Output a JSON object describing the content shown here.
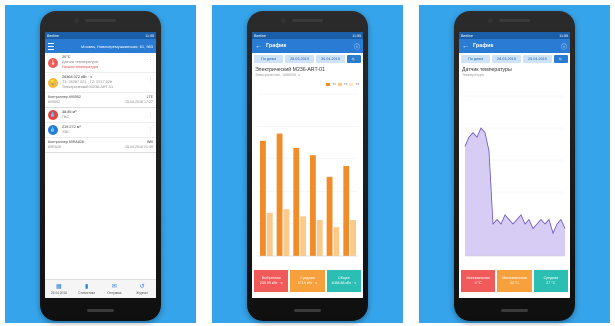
{
  "colors": {
    "background": "#36a4ea",
    "appbar": "#2a7bd4",
    "statusbar": "#1a5ea8",
    "bar_dark": "#f28c28",
    "bar_light": "#fbc98a",
    "line": "#6a4fc9",
    "area": "#cfc3f2",
    "stat_red": "#f05a5a",
    "stat_orange": "#f6a13c",
    "stat_teal": "#2bbfb3"
  },
  "phone1": {
    "status_left": "Beeline",
    "status_right": "11:55",
    "title": "Москва, Новочеремушкинская, 61, 983",
    "items": [
      {
        "icon": "thermometer-icon",
        "color": "#f05a5a",
        "value": "20°C",
        "sub1": "Датчик температуры",
        "sub2": "Низкая температура"
      },
      {
        "icon": "bulb-icon",
        "color": "#f6b73c",
        "value": "26364.072 кВт · ч",
        "sub1": "Т1: 26287.021 ; Т2: 9717.026",
        "sub2": "Электрический М236-АRT-01"
      }
    ],
    "device1": {
      "name": "Контроллер 690552",
      "status": "LTE",
      "id": "690552",
      "time": "25.04.2018 17:27"
    },
    "items2": [
      {
        "icon": "drop-icon",
        "color": "#e8413f",
        "value": "38.85 м³",
        "sub1": "ГВС"
      },
      {
        "icon": "drop-icon",
        "color": "#2a7bd4",
        "value": "219.272 м³",
        "sub1": "ХВС"
      }
    ],
    "device2": {
      "name": "Контроллер 69RA828",
      "status": "Wifi",
      "id": "69RA28",
      "time": "25.04.2018 21:49"
    },
    "nav": [
      {
        "icon": "calendar-icon",
        "label": "25.04.2018"
      },
      {
        "icon": "stats-icon",
        "label": "Статистика"
      },
      {
        "icon": "mail-icon",
        "label": "Отправка"
      },
      {
        "icon": "history-icon",
        "label": "Журнал"
      }
    ]
  },
  "phone2": {
    "status_left": "Beeline",
    "status_right": "11:55",
    "title": "График",
    "filter": {
      "period": "По дням",
      "from": "28.03.2019",
      "to": "30.04.2019"
    },
    "chart_title": "Электрический М236-АRT-01",
    "chart_sub": "Электричество, 1686936, ч",
    "legend": [
      "Т1",
      "Т2",
      "Т3"
    ],
    "stats": [
      {
        "label": "Выбранная",
        "value": "230.99 кВт · ч"
      },
      {
        "label": "Средняя",
        "value": "3719 кВт · ч"
      },
      {
        "label": "Общее",
        "value": "4088.88 кВт · ч"
      }
    ]
  },
  "phone3": {
    "status_left": "Beeline",
    "status_right": "11:55",
    "title": "График",
    "filter": {
      "period": "По дням",
      "from": "28.03.2019",
      "to": "25.04.2019"
    },
    "chart_title": "Датчик температуры",
    "chart_sub": "Температура",
    "stats": [
      {
        "label": "Минимальная",
        "value": "0 °C"
      },
      {
        "label": "Максимальная",
        "value": "30 °C"
      },
      {
        "label": "Средняя",
        "value": "27 °C"
      }
    ]
  },
  "chart_data": [
    {
      "type": "bar",
      "title": "Электрический М236-АRT-01",
      "categories": [
        "1",
        "2",
        "3",
        "4",
        "5",
        "6"
      ],
      "series": [
        {
          "name": "Т1",
          "values": [
            160,
            170,
            150,
            140,
            110,
            125
          ]
        },
        {
          "name": "Т2",
          "values": [
            60,
            65,
            55,
            50,
            40,
            50
          ]
        }
      ],
      "ylim": [
        0,
        225
      ]
    },
    {
      "type": "area",
      "title": "Датчик температуры",
      "x": [
        0,
        1,
        2,
        3,
        4,
        5,
        6,
        7,
        8,
        9,
        10,
        11,
        12,
        13,
        14,
        15,
        16,
        17,
        18,
        19,
        20,
        21,
        22,
        23,
        24,
        25
      ],
      "series": [
        {
          "values": [
            24,
            26,
            27,
            26,
            28,
            27,
            23,
            7,
            8,
            7,
            9,
            8,
            7,
            8,
            9,
            7,
            8,
            6,
            7,
            8,
            7,
            8,
            5,
            7,
            8,
            6
          ]
        }
      ],
      "ylim": [
        0,
        35
      ]
    }
  ]
}
